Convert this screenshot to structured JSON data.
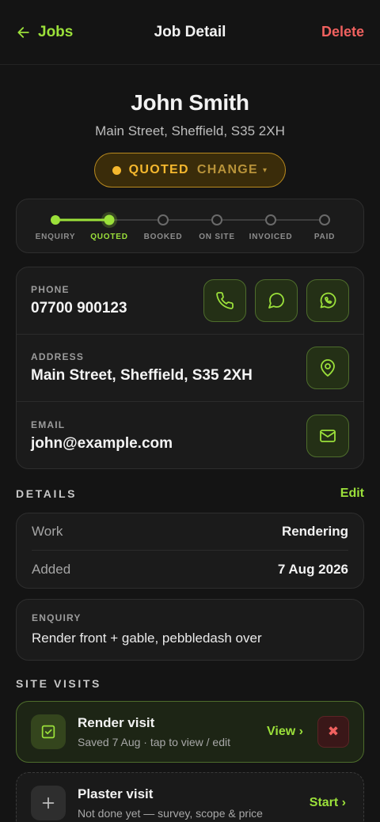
{
  "topbar": {
    "back_label": "Jobs",
    "title": "Job Detail",
    "delete_label": "Delete"
  },
  "customer": {
    "name": "John Smith",
    "address": "Main Street, Sheffield, S35 2XH"
  },
  "status": {
    "label": "QUOTED",
    "change_label": "CHANGE",
    "color": "#f5b82e"
  },
  "progress": {
    "current_index": 1,
    "steps": [
      "ENQUIRY",
      "QUOTED",
      "BOOKED",
      "ON SITE",
      "INVOICED",
      "PAID"
    ]
  },
  "contact": {
    "phone_label": "PHONE",
    "phone": "07700 900123",
    "address_label": "ADDRESS",
    "address": "Main Street, Sheffield, S35 2XH",
    "email_label": "EMAIL",
    "email": "john@example.com"
  },
  "details": {
    "heading": "DETAILS",
    "edit_label": "Edit",
    "rows": [
      {
        "key": "Work",
        "value": "Rendering"
      },
      {
        "key": "Added",
        "value": "7 Aug 2026"
      }
    ]
  },
  "enquiry": {
    "label": "ENQUIRY",
    "text": "Render front + gable, pebbledash over"
  },
  "site_visits": {
    "heading": "SITE VISITS",
    "items": [
      {
        "title": "Render visit",
        "subtitle": "Saved 7 Aug · tap to view / edit",
        "action": "View ›",
        "delete_glyph": "✖"
      },
      {
        "title": "Plaster visit",
        "subtitle": "Not done yet — survey, scope & price",
        "action": "Start ›"
      }
    ]
  },
  "colors": {
    "accent": "#9be03a",
    "danger": "#f0615f",
    "background": "#141414"
  }
}
